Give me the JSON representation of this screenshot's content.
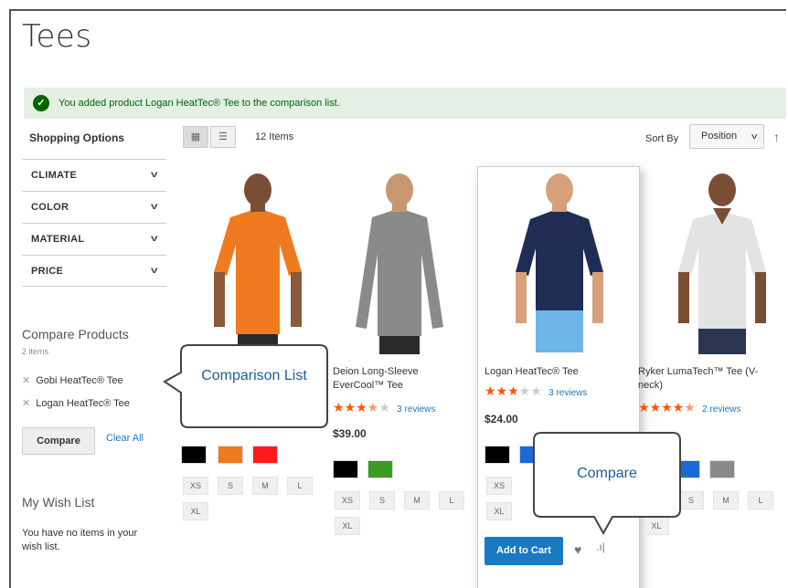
{
  "page": {
    "title": "Tees"
  },
  "message": {
    "text": "You added product Logan HeatTec® Tee to the comparison list."
  },
  "sidebar": {
    "title": "Shopping Options",
    "filters": [
      "CLIMATE",
      "COLOR",
      "MATERIAL",
      "PRICE"
    ],
    "compare": {
      "title": "Compare Products",
      "count": "2 items",
      "items": [
        "Gobi HeatTec® Tee",
        "Logan HeatTec® Tee"
      ],
      "compare_label": "Compare",
      "clear_label": "Clear All"
    },
    "wishlist": {
      "title": "My Wish List",
      "text": "You have no items in your wish list."
    }
  },
  "toolbar": {
    "count": "12 Items",
    "sort_label": "Sort By",
    "sort_value": "Position"
  },
  "products": [
    {
      "name": "",
      "price": "",
      "reviews": "",
      "rating": 0,
      "shirt_color": "#f07a1f",
      "swatches": [
        "#000000",
        "#f07a1f",
        "#ff1a1a"
      ],
      "sizes": [
        "XS",
        "S",
        "M",
        "L",
        "XL"
      ]
    },
    {
      "name": "Deion Long-Sleeve EverCool™ Tee",
      "price": "$39.00",
      "reviews": "3 reviews",
      "rating": 3.5,
      "shirt_color": "#8a8a8a",
      "swatches": [
        "#000000",
        "#3a9d23"
      ],
      "sizes": [
        "XS",
        "S",
        "M",
        "L",
        "XL"
      ]
    },
    {
      "name": "Logan HeatTec® Tee",
      "price": "$24.00",
      "reviews": "3 reviews",
      "rating": 3,
      "shirt_color": "#1f2d55",
      "swatches": [
        "#000000",
        "#1a6ad6"
      ],
      "sizes": [
        "XS",
        "XL"
      ],
      "add_to_cart": "Add to Cart"
    },
    {
      "name": "Ryker LumaTech™ Tee (V-neck)",
      "price": "",
      "reviews": "2 reviews",
      "rating": 4.5,
      "shirt_color": "#e3e3e3",
      "swatches": [
        "#1a6ad6",
        "#8a8a8a"
      ],
      "sizes": [
        "S",
        "M",
        "L",
        "XL"
      ]
    }
  ],
  "callouts": {
    "comparison": "Comparison List",
    "compare": "Compare"
  }
}
